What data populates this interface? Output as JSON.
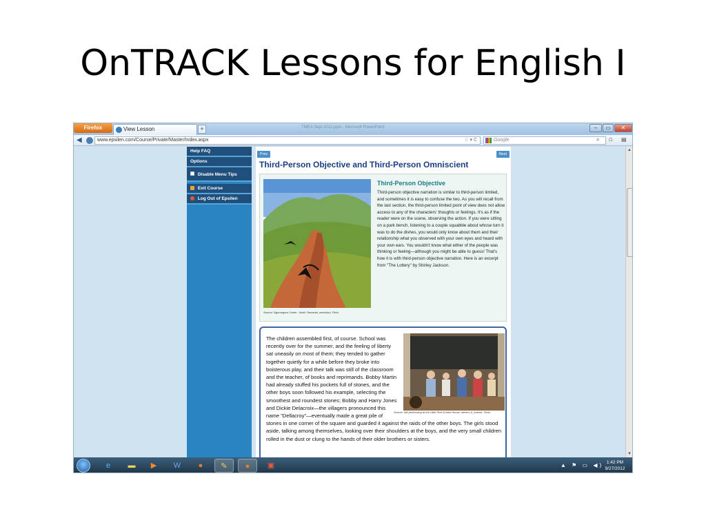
{
  "slide": {
    "title": "OnTRACK Lessons for English I"
  },
  "browser": {
    "firefox_button": "Firefox",
    "tab_title": "View Lesson",
    "new_tab": "+",
    "faded_title": "TMEA Sept 2012.pptx - Microsoft PowerPoint",
    "url_domain": "epsilen.com",
    "url": "www.epsilen.com/Course/Private/Master/Index.aspx",
    "url_controls": "☆ ▾ C",
    "search_placeholder": "Google"
  },
  "sidebar": {
    "items": [
      {
        "label": "Help FAQ"
      },
      {
        "label": "Options"
      },
      {
        "label": "Disable Menu Tips"
      },
      {
        "label": "Exit Course"
      },
      {
        "label": "Log Out of Epsilen"
      }
    ]
  },
  "lesson": {
    "prev_label": "Prev",
    "next_label": "Next",
    "title": "Third-Person Objective and Third-Person Omniscient",
    "section_heading": "Third-Person Objective",
    "section_text": "Third-person objective narration is similar to third-person limited, and sometimes it is easy to confuse the two. As you will recall from the last section, the third-person limited point of view does not allow access to any of the characters' thoughts or feelings. It's as if the reader were on the scene, observing the action. If you were sitting on a park bench, listening to a couple squabble about whose turn it was to do the dishes, you would only know about them and their relationship what you observed with your own eyes and heard with your own ears. You wouldn't know what either of the people was thinking or feeling—although you might be able to guess! That's how it is with third-person objective narration. Here is an excerpt from \"The Lottery\" by Shirley Jackson.",
    "photo1_caption": "Source: Ngorongoro Crater - North Tanzania, zeebuhut, Flickr",
    "excerpt_text": "The children assembled first, of course. School was recently over for the summer, and the feeling of liberty sat uneasily on most of them; they tended to gather together quietly for a while before they broke into boisterous play, and their talk was still of the classroom and the teacher, of books and reprimands. Bobby Martin had already stuffed his pockets full of stones, and the other boys soon followed his example, selecting the smoothest and roundest stones; Bobby and Harry Jones and Dickie Delacroix—the villagers pronounced this name \"Dellacroy\"—eventually made a great pile of stones in one corner of the square and guarded it against the raids of the other boys. The girls stood aside, talking among themselves, looking over their shoulders at the boys, and the very small children rolled in the dust or clung to the hands of their older brothers or sisters.",
    "photo2_caption": "Source: 4M performing at the Little Red School House, steven_b_kreuse, Flickr"
  },
  "taskbar": {
    "clock_time": "1:42 PM",
    "clock_date": "9/27/2012",
    "tray_icons": "▲ ⚑ ▭ ◀)"
  },
  "colors": {
    "sidebar_bg": "#2b84c2",
    "sidebar_item_bg": "#1f4f7d",
    "lesson_title": "#1a3f86",
    "section_heading": "#1b7b86",
    "excerpt_border": "#3b63a8",
    "page_bg": "#cfe3f0"
  }
}
